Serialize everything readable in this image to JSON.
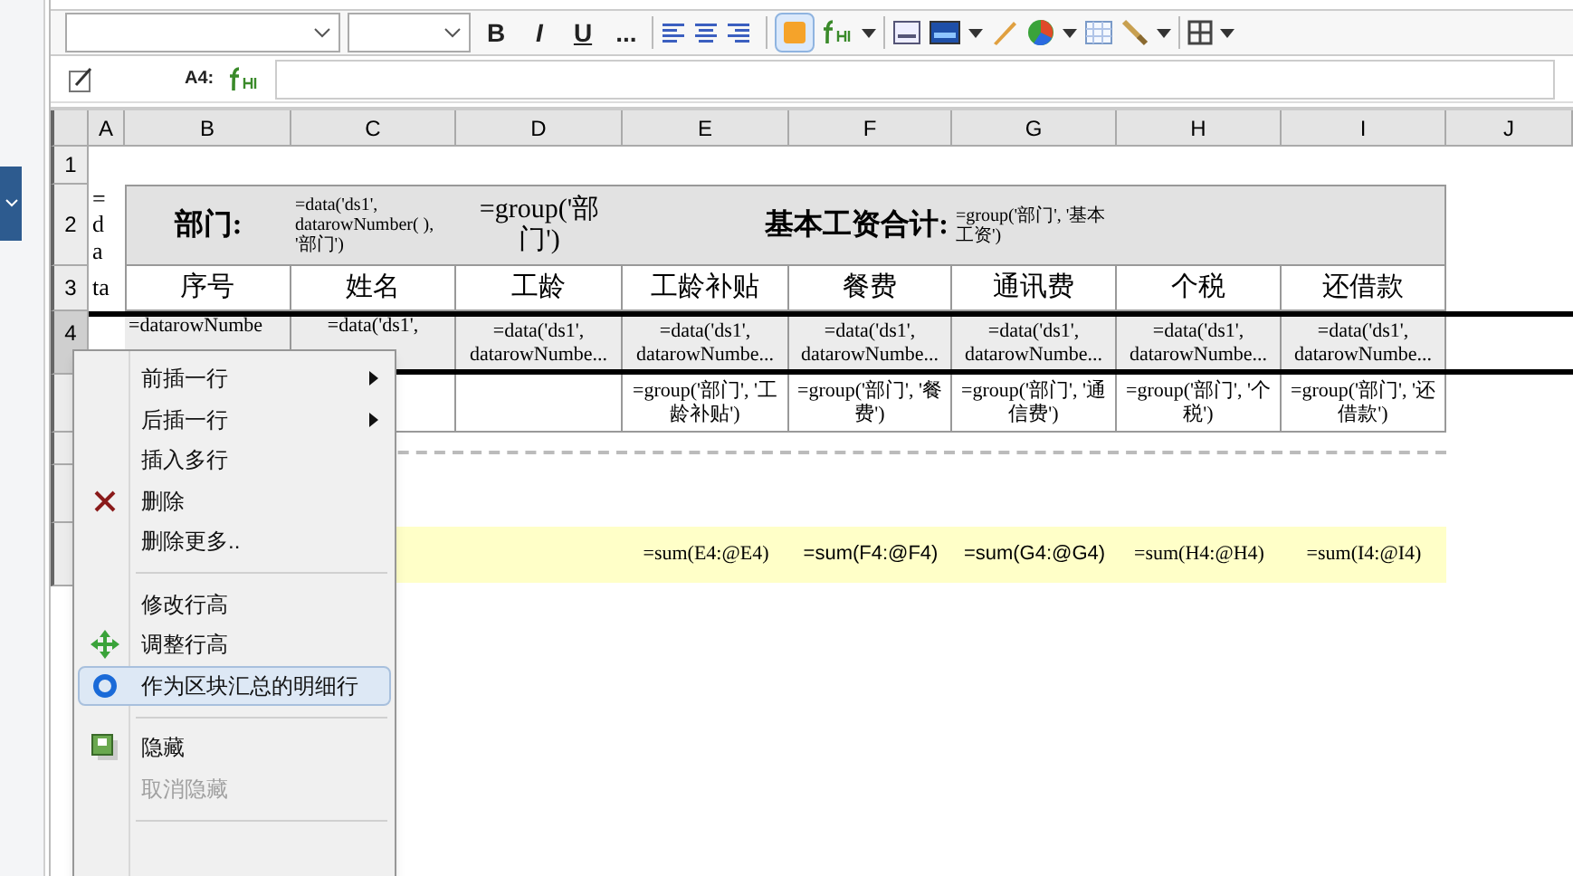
{
  "toolbar": {
    "text_buttons": [
      "B",
      "I",
      "U",
      "..."
    ],
    "cell_style_button": {
      "selected": true
    }
  },
  "formula_bar": {
    "cell_ref": "A4:"
  },
  "sheet": {
    "columns": [
      "A",
      "B",
      "C",
      "D",
      "E",
      "F",
      "G",
      "H",
      "I",
      "J"
    ],
    "rows": [
      {
        "number": "1",
        "kind": "blank",
        "selected": false,
        "cells": {}
      },
      {
        "number": "2",
        "kind": "title",
        "selected": false,
        "cells": {
          "A": "= da",
          "B": "部门:",
          "C": "=data('ds1', datarowNumber( ), '部门')",
          "D": "=group('部门')",
          "E": "基本工资合计:",
          "G": "=group('部门', '基本工资')"
        }
      },
      {
        "number": "3",
        "kind": "header",
        "selected": false,
        "cells": {
          "A": "ta",
          "B": "序号",
          "C": "姓名",
          "D": "工龄",
          "E": "工龄补贴",
          "F": "餐费",
          "G": "通讯费",
          "H": "个税",
          "I": "还借款"
        }
      },
      {
        "number": "4",
        "kind": "detail",
        "selected": true,
        "cells": {
          "B": "=datarowNumbe",
          "C": "=data('ds1',",
          "D": "=data('ds1', datarowNumbe...",
          "E": "=data('ds1', datarowNumbe...",
          "F": "=data('ds1', datarowNumbe...",
          "G": "=data('ds1', datarowNumbe...",
          "H": "=data('ds1', datarowNumbe...",
          "I": "=data('ds1', datarowNumbe..."
        }
      },
      {
        "kind": "group",
        "selected": false,
        "cells": {
          "E": "=group('部门', '工龄补贴')",
          "F": "=group('部门', '餐费')",
          "G": "=group('部门', '通信费')",
          "H": "=group('部门', '个税')",
          "I": "=group('部门', '还借款')"
        }
      },
      {
        "kind": "divider",
        "selected": false,
        "cells": {}
      },
      {
        "kind": "blank",
        "selected": false,
        "cells": {}
      },
      {
        "kind": "sum",
        "selected": false,
        "cells": {
          "E": "=sum(E4:@E4)",
          "F": "=sum(F4:@F4)",
          "G": "=sum(G4:@G4)",
          "H": "=sum(H4:@H4)",
          "I": "=sum(I4:@I4)"
        }
      }
    ]
  },
  "context_menu": [
    {
      "kind": "item",
      "label": "前插一行",
      "submenu": true,
      "selected": false,
      "disabled": false
    },
    {
      "kind": "item",
      "label": "后插一行",
      "submenu": true,
      "selected": false,
      "disabled": false
    },
    {
      "kind": "item",
      "label": "插入多行",
      "submenu": false,
      "selected": false,
      "disabled": false
    },
    {
      "kind": "delete",
      "label": "删除",
      "submenu": false,
      "selected": false,
      "disabled": false
    },
    {
      "kind": "item",
      "label": "删除更多..",
      "submenu": false,
      "selected": false,
      "disabled": false
    },
    {
      "kind": "separator"
    },
    {
      "kind": "item",
      "label": "修改行高",
      "submenu": false,
      "selected": false,
      "disabled": false
    },
    {
      "kind": "resize",
      "label": "调整行高",
      "submenu": false,
      "selected": false,
      "disabled": false
    },
    {
      "kind": "detail",
      "label": "作为区块汇总的明细行",
      "submenu": false,
      "selected": true,
      "disabled": false
    },
    {
      "kind": "separator"
    },
    {
      "kind": "hide",
      "label": "隐藏",
      "submenu": false,
      "selected": false,
      "disabled": false
    },
    {
      "kind": "item",
      "label": "取消隐藏",
      "submenu": false,
      "selected": false,
      "disabled": true
    },
    {
      "kind": "separator"
    }
  ]
}
